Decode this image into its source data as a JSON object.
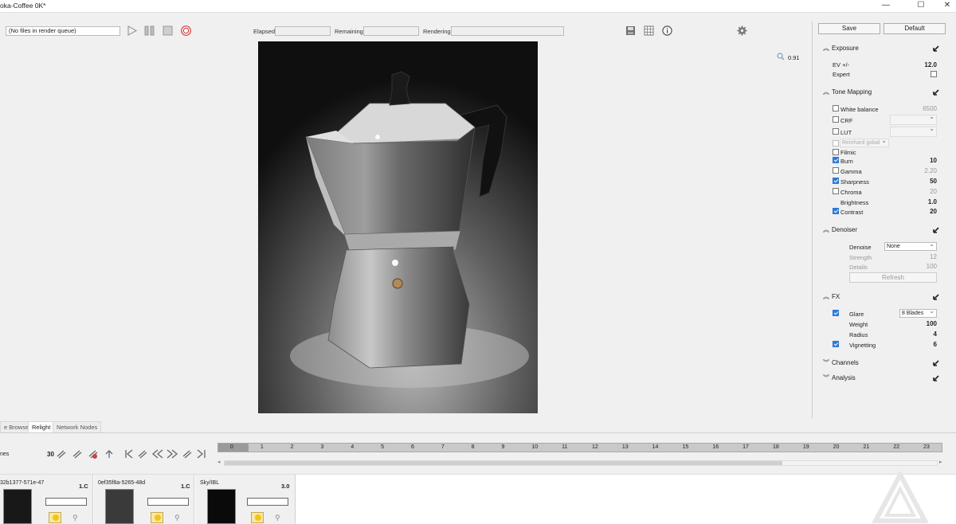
{
  "window": {
    "title": "oka-Coffee 0K*",
    "minimize": "—",
    "maximize": "☐",
    "close": "✕"
  },
  "toolbar": {
    "queue_text": "(No files in render queue)",
    "elapsed_label": "Elapsed",
    "remaining_label": "Remaining",
    "rendering_label": "Rendering"
  },
  "viewport": {
    "zoom": "0.91"
  },
  "panel": {
    "save": "Save",
    "default": "Default",
    "exposure": {
      "title": "Exposure",
      "ev_label": "EV +/-",
      "ev_value": "12.0",
      "expert_label": "Expert"
    },
    "tone": {
      "title": "Tone Mapping",
      "white_balance_label": "White balance",
      "white_balance_value": "6500",
      "crf_label": "CRF",
      "lut_label": "LUT",
      "reinhard": "Reinhard gobal",
      "filmic": "Filmic",
      "burn_label": "Burn",
      "burn_value": "10",
      "gamma_label": "Gamma",
      "gamma_value": "2.20",
      "sharpness_label": "Sharpness",
      "sharpness_value": "50",
      "chroma_label": "Chroma",
      "chroma_value": "20",
      "brightness_label": "Brightness",
      "brightness_value": "1.0",
      "contrast_label": "Contrast",
      "contrast_value": "20"
    },
    "denoiser": {
      "title": "Denoiser",
      "denoise_label": "Denoise",
      "denoise_value": "None",
      "strength_label": "Strength",
      "strength_value": "12",
      "details_label": "Details",
      "details_value": "100",
      "refresh": "Refresh"
    },
    "fx": {
      "title": "FX",
      "glare_label": "Glare",
      "glare_value": "8 Blades",
      "weight_label": "Weight",
      "weight_value": "100",
      "radius_label": "Radius",
      "radius_value": "4",
      "vignetting_label": "Vignetting",
      "vignetting_value": "6"
    },
    "channels": "Channels",
    "analysis": "Analysis"
  },
  "tabs": {
    "browser": "e Browser",
    "relight": "Relight",
    "network": "Network Nodes"
  },
  "timeline": {
    "frames_label": "nes",
    "fps": "30",
    "ticks": [
      "0",
      "1",
      "2",
      "3",
      "4",
      "5",
      "6",
      "7",
      "8",
      "9",
      "10",
      "11",
      "12",
      "13",
      "14",
      "15",
      "16",
      "17",
      "18",
      "19",
      "20",
      "21",
      "22",
      "23"
    ]
  },
  "cards": [
    {
      "name": "32b1377-571e-47",
      "value": "1.C"
    },
    {
      "name": "0ef35f8a-5265-48d",
      "value": "1.C"
    },
    {
      "name": "Sky/IBL",
      "value": "3.0"
    }
  ],
  "colors": {
    "accent": "#2d7ad6",
    "record": "#d04040",
    "timeline": "#c9c9c9"
  }
}
